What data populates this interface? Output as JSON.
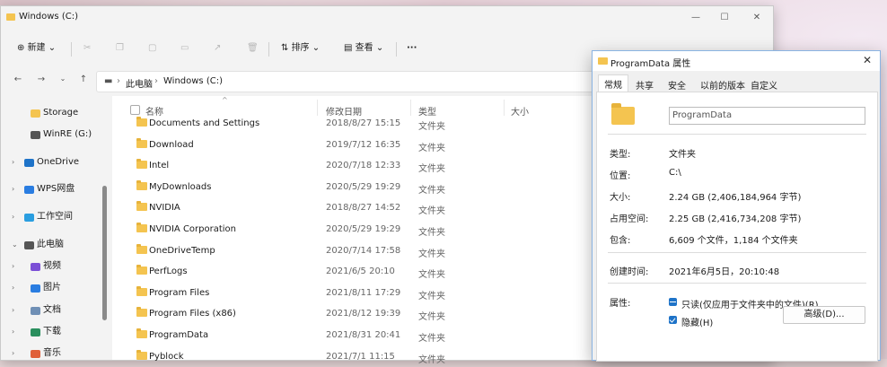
{
  "explorer": {
    "title": "Windows (C:)",
    "toolbar": {
      "new": "新建",
      "sort": "排序",
      "view": "查看",
      "more": "···"
    },
    "address": {
      "computer": "此电脑",
      "drive": "Windows (C:)"
    },
    "sidebar": {
      "items": [
        {
          "label": "Storage",
          "icon": "folder-icon",
          "color": "#f4c450"
        },
        {
          "label": "WinRE (G:)",
          "icon": "drive-icon",
          "color": "#555555"
        },
        {
          "label": "OneDrive",
          "icon": "cloud-icon",
          "color": "#1e73c8"
        },
        {
          "label": "WPS网盘",
          "icon": "cloud-icon",
          "color": "#2a7de1"
        },
        {
          "label": "工作空间",
          "icon": "workspace-icon",
          "color": "#2a9ee0"
        },
        {
          "label": "此电脑",
          "icon": "computer-icon",
          "color": "#555555"
        },
        {
          "label": "视频",
          "icon": "video-icon",
          "color": "#7b4fd6"
        },
        {
          "label": "图片",
          "icon": "picture-icon",
          "color": "#2a7de1"
        },
        {
          "label": "文档",
          "icon": "document-icon",
          "color": "#6f8fb5"
        },
        {
          "label": "下载",
          "icon": "download-icon",
          "color": "#2a8f5e"
        },
        {
          "label": "音乐",
          "icon": "music-icon",
          "color": "#e0603a"
        }
      ]
    },
    "columns": {
      "name": "名称",
      "date": "修改日期",
      "type": "类型",
      "size": "大小"
    },
    "files": [
      {
        "name": "Documents and Settings",
        "date": "2018/8/27 15:15",
        "type": "文件夹"
      },
      {
        "name": "Download",
        "date": "2019/7/12 16:35",
        "type": "文件夹"
      },
      {
        "name": "Intel",
        "date": "2020/7/18 12:33",
        "type": "文件夹"
      },
      {
        "name": "MyDownloads",
        "date": "2020/5/29 19:29",
        "type": "文件夹"
      },
      {
        "name": "NVIDIA",
        "date": "2018/8/27 14:52",
        "type": "文件夹"
      },
      {
        "name": "NVIDIA Corporation",
        "date": "2020/5/29 19:29",
        "type": "文件夹"
      },
      {
        "name": "OneDriveTemp",
        "date": "2020/7/14 17:58",
        "type": "文件夹"
      },
      {
        "name": "PerfLogs",
        "date": "2021/6/5 20:10",
        "type": "文件夹"
      },
      {
        "name": "Program Files",
        "date": "2021/8/11 17:29",
        "type": "文件夹"
      },
      {
        "name": "Program Files (x86)",
        "date": "2021/8/12 19:39",
        "type": "文件夹"
      },
      {
        "name": "ProgramData",
        "date": "2021/8/31 20:41",
        "type": "文件夹"
      },
      {
        "name": "Pyblock",
        "date": "2021/7/1 11:15",
        "type": "文件夹"
      }
    ]
  },
  "properties": {
    "title": "ProgramData 属性",
    "tabs": [
      "常规",
      "共享",
      "安全",
      "以前的版本",
      "自定义"
    ],
    "folder_name": "ProgramData",
    "fields": {
      "type_label": "类型:",
      "type_value": "文件夹",
      "location_label": "位置:",
      "location_value": "C:\\",
      "size_label": "大小:",
      "size_value": "2.24 GB (2,406,184,964 字节)",
      "disk_label": "占用空间:",
      "disk_value": "2.25 GB (2,416,734,208 字节)",
      "contains_label": "包含:",
      "contains_value": "6,609 个文件，1,184 个文件夹",
      "created_label": "创建时间:",
      "created_value": "2021年6月5日，20:10:48",
      "attributes_label": "属性:"
    },
    "attributes": {
      "readonly": "只读(仅应用于文件夹中的文件)(R)",
      "hidden": "隐藏(H)",
      "advanced": "高级(D)..."
    },
    "close": "✕"
  },
  "colors": {
    "accent": "#1e73c8",
    "folder": "#f4c450"
  }
}
